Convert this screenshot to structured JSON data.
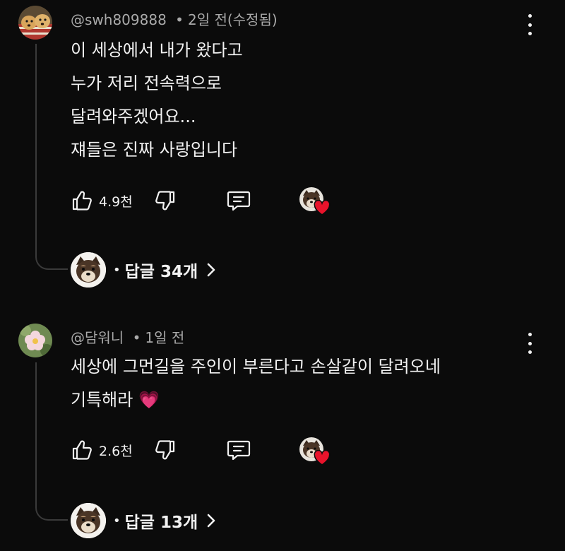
{
  "comments": [
    {
      "handle": "@swh809888",
      "separator": "•",
      "time": "2일 전(수정됨)",
      "lines": [
        "이 세상에서 내가 왔다고",
        "누가 저리 전속력으로",
        "달려와주겠어요...",
        "쟤들은 진짜 사랑입니다"
      ],
      "likes": "4.9천",
      "replies_label": "답글 34개",
      "icons": {
        "like": "thumbs-up-icon",
        "dislike": "thumbs-down-icon",
        "reply": "comment-icon",
        "more": "more-vertical-icon",
        "heart": "heart-icon"
      }
    },
    {
      "handle": "@담워니",
      "separator": "•",
      "time": "1일 전",
      "lines": [
        "세상에 그먼길을 주인이 부른다고 손살같이 달려오네",
        "기특해라 💗"
      ],
      "likes": "2.6천",
      "replies_label": "답글 13개"
    }
  ],
  "colors": {
    "background": "#0b0b0b",
    "text": "#f1f1f1",
    "meta": "#aaaaaa",
    "heart": "#e8132b",
    "thread": "#3a3a3a"
  },
  "reply_bullet": "•"
}
